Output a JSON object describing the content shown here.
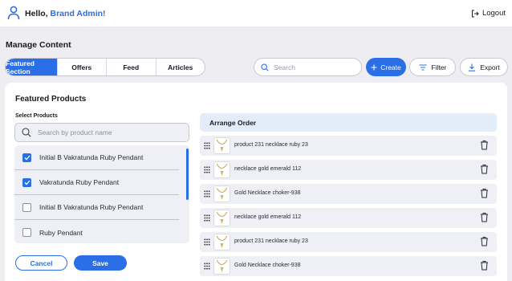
{
  "header": {
    "greeting": "Hello, ",
    "user_name": "Brand Admin!",
    "logout_label": "Logout"
  },
  "page": {
    "title": "Manage Content",
    "tabs": [
      {
        "label": "Featured Section",
        "active": true
      },
      {
        "label": "Offers",
        "active": false
      },
      {
        "label": "Feed",
        "active": false
      },
      {
        "label": "Articles",
        "active": false
      }
    ]
  },
  "toolbar": {
    "search_placeholder": "Search",
    "create_label": "Create",
    "filter_label": "Filter",
    "export_label": "Export"
  },
  "panel": {
    "title": "Featured Products",
    "select_label": "Select Products",
    "product_search_placeholder": "Search by product name",
    "products": [
      {
        "name": "Initial B Vakratunda Ruby Pendant",
        "checked": true
      },
      {
        "name": "Vakratunda Ruby Pendant",
        "checked": true
      },
      {
        "name": "Initial B Vakratunda Ruby Pendant",
        "checked": false
      },
      {
        "name": "Ruby Pendant",
        "checked": false
      }
    ],
    "cancel_label": "Cancel",
    "save_label": "Save",
    "order_heading": "Arrange Order",
    "order_items": [
      {
        "name": "product 231 necklace ruby 23"
      },
      {
        "name": "necklace gold emerald 112"
      },
      {
        "name": "Gold Necklace choker-938"
      },
      {
        "name": "necklace gold emerald 112"
      },
      {
        "name": "product 231 necklace ruby 23"
      },
      {
        "name": "Gold Necklace choker-938"
      }
    ]
  },
  "colors": {
    "accent": "#2b6fe6",
    "background": "#eeeef2",
    "list_bg": "#eef0f6",
    "order_header_bg": "#e3edfa"
  },
  "icons": [
    "user-icon",
    "logout-icon",
    "search-icon",
    "plus-icon",
    "filter-icon",
    "download-icon",
    "checkbox-icon",
    "drag-handle-icon",
    "necklace-thumbnail",
    "trash-icon"
  ]
}
